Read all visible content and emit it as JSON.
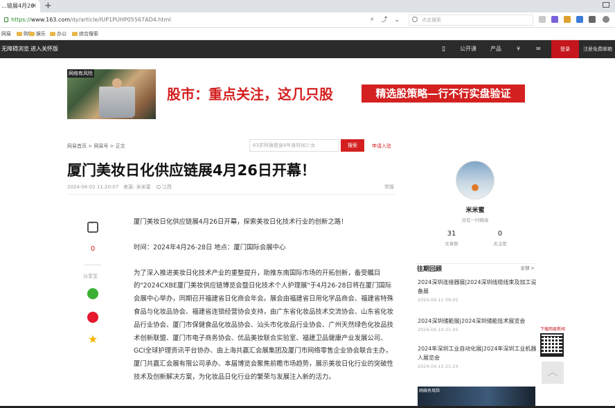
{
  "browser": {
    "tab_title": "…链展4月26",
    "url_scheme": "https://",
    "url_host": "www.163.com",
    "url_path": "/dy/article/IUP1PUHP05567AD4.html",
    "search_placeholder": "点击搜索"
  },
  "bookmarks": {
    "item1": "网易",
    "item2": "购物",
    "item3": "娱乐",
    "item4": "办公",
    "item5": "综合搜索"
  },
  "topnav": {
    "left1": "无障碍浏览",
    "left2": "进入关怀版",
    "open_class": "公开课",
    "products": "产品",
    "money": "¥",
    "login": "登录",
    "register": "注册免费邮箱"
  },
  "banner": {
    "stamp": "网络有风险",
    "headline": "股市：重点关注，这几只股",
    "badge": "精选股策略—行不行实盘验证"
  },
  "crumb": {
    "home": "网易首页",
    "sep": " > ",
    "section": "网易号",
    "current": "正文"
  },
  "site_search": {
    "placeholder": "63岁阿姨健身8年身材如少女",
    "button": "搜索",
    "apply": "申请入驻"
  },
  "article": {
    "title": "厦门美妆日化供应链展4月26日开幕！",
    "datetime": "2024-04-02 11:20:07",
    "source_label": "来源:",
    "source": "米米蜜",
    "location": "江西",
    "report": "举报",
    "p1": "厦门美妆日化供应链展4月26日开幕，探索美妆日化技术行业的创新之路！",
    "p2": "时间：2024年4月26-28日 地点：厦门国际会展中心",
    "p3": "为了深入推进美妆日化技术产业的重整提升，助推东南国际市场的开拓创新，备受瞩目的\"2024CXBE厦门美妆供应链博览会暨日化技术个人护理展\"于4月26-28日将在厦门国际会展中心举办，同期召开福建省日化商会年会。展会由福建省日用化学品商会、福建省特殊食品与化妆品协会、福建省连锁经营协会支持，由广东省化妆品技术交流协会、山东省化妆品行业协会、厦门市保健食品化妆品协会、汕头市化妆品行业协会、广州天然绿色化妆品技术创新联盟、厦门市电子商务协会、优品美妆联合实验室、福建卫品健康产业发展公司、GCI全球护理资讯平台协办、由上海共赢汇会展集团及厦门市网络零售企业协会联合主办，厦门共赢汇会展有限公司承办、本届博览会聚焦前瞻市场趋势，展示美妆日化行业的突破性技术及创新解决方案，为化妆品日化行业的繁荣与发展注入新的活力。"
  },
  "tools": {
    "comment_count": "0",
    "share_label": "分享至"
  },
  "author": {
    "name": "米米蜜",
    "sub": "没有一时精高",
    "articles_count": "31",
    "articles_label": "文章数",
    "followers_count": "0",
    "followers_label": "关注度"
  },
  "past": {
    "title": "往期回顾",
    "all": "全部 >",
    "items": [
      {
        "title": "2024深圳连接器展|2024深圳线缆线束及加工设备展",
        "date": "2024-04-11 09:05"
      },
      {
        "title": "2024深圳储能展|2024深圳储能技术展览会",
        "date": "2024-04-10 21:45"
      },
      {
        "title": "2024年深圳工业自动化展|2024年深圳工业机器人展览会",
        "date": "2024-04-10 21:24"
      }
    ]
  },
  "qr": {
    "caption": "下载网易新闻"
  },
  "thumb": {
    "caption": "网络有风险"
  },
  "colors": {
    "accent": "#d42020",
    "nav": "#2b2b2b"
  }
}
